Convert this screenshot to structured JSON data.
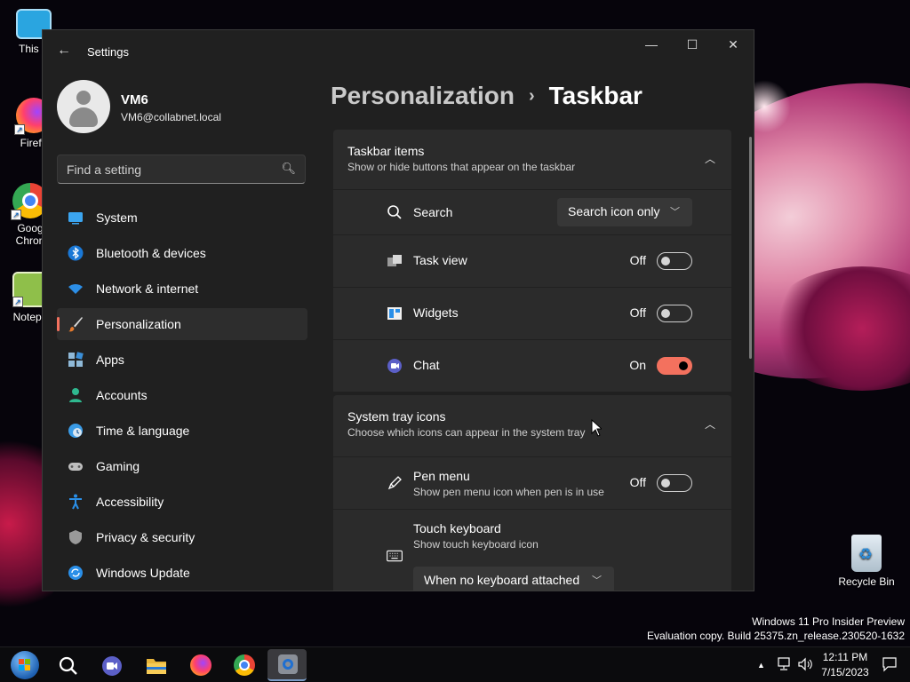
{
  "desktop": {
    "icons": [
      {
        "label": "This P"
      },
      {
        "label": "Firefo"
      },
      {
        "label": "Goog Chron"
      },
      {
        "label": "Notepa"
      },
      {
        "label": "Recycle Bin"
      }
    ],
    "watermark_line1": "Windows 11 Pro Insider Preview",
    "watermark_line2": "Evaluation copy. Build 25375.zn_release.230520-1632"
  },
  "window": {
    "title": "Settings",
    "controls": {
      "minimize": "—",
      "maximize": "☐",
      "close": "✕"
    }
  },
  "profile": {
    "name": "VM6",
    "email": "VM6@collabnet.local"
  },
  "search": {
    "placeholder": "Find a setting"
  },
  "nav": {
    "items": [
      {
        "label": "System",
        "icon": "monitor-icon"
      },
      {
        "label": "Bluetooth & devices",
        "icon": "bluetooth-icon"
      },
      {
        "label": "Network & internet",
        "icon": "wifi-icon"
      },
      {
        "label": "Personalization",
        "icon": "brush-icon",
        "active": true
      },
      {
        "label": "Apps",
        "icon": "apps-icon"
      },
      {
        "label": "Accounts",
        "icon": "person-icon"
      },
      {
        "label": "Time & language",
        "icon": "globe-icon"
      },
      {
        "label": "Gaming",
        "icon": "gamepad-icon"
      },
      {
        "label": "Accessibility",
        "icon": "accessibility-icon"
      },
      {
        "label": "Privacy & security",
        "icon": "shield-icon"
      },
      {
        "label": "Windows Update",
        "icon": "update-icon"
      }
    ]
  },
  "breadcrumb": {
    "parent": "Personalization",
    "separator": "›",
    "current": "Taskbar"
  },
  "taskbar_items": {
    "title": "Taskbar items",
    "subtitle": "Show or hide buttons that appear on the taskbar",
    "search": {
      "label": "Search",
      "value": "Search icon only"
    },
    "task_view": {
      "label": "Task view",
      "state": "Off"
    },
    "widgets": {
      "label": "Widgets",
      "state": "Off"
    },
    "chat": {
      "label": "Chat",
      "state": "On"
    }
  },
  "system_tray": {
    "title": "System tray icons",
    "subtitle": "Choose which icons can appear in the system tray",
    "pen_menu": {
      "label": "Pen menu",
      "desc": "Show pen menu icon when pen is in use",
      "state": "Off"
    },
    "touch_keyboard": {
      "label": "Touch keyboard",
      "desc": "Show touch keyboard icon",
      "value": "When no keyboard attached"
    }
  },
  "taskbar": {
    "time": "12:11 PM",
    "date": "7/15/2023"
  },
  "colors": {
    "accent": "#f3715e",
    "window_bg": "#202020",
    "card_bg": "#2b2b2b"
  }
}
